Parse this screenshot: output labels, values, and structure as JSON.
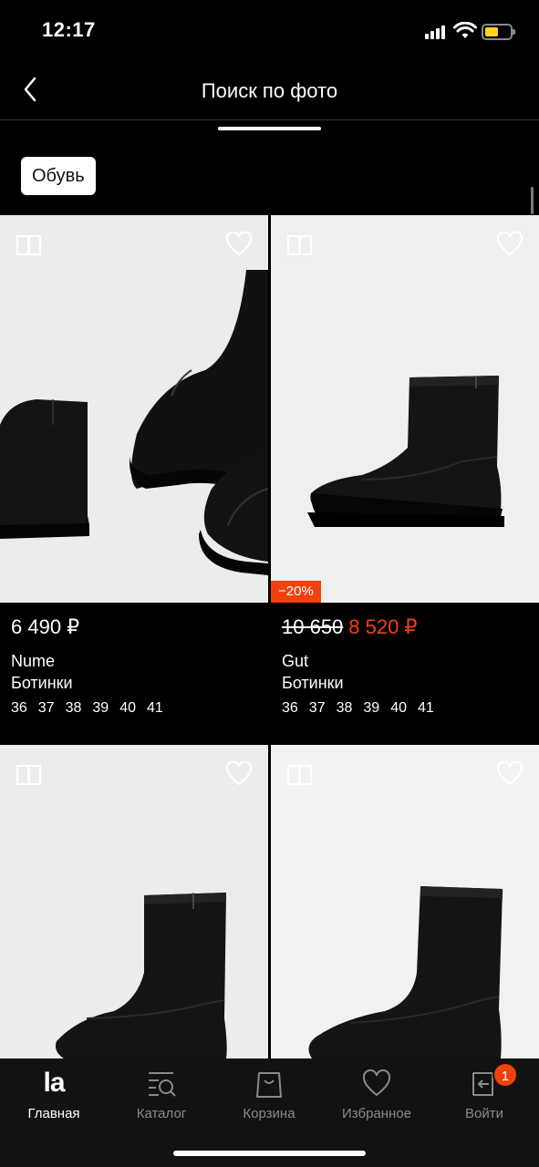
{
  "status_bar": {
    "time": "12:17",
    "battery_level": 0.55,
    "battery_color": "#ffd60a"
  },
  "header": {
    "title": "Поиск по фото",
    "back_icon": "chevron-left-icon"
  },
  "filter": {
    "chip_label": "Обувь"
  },
  "accent_color": "#f0410f",
  "products": [
    {
      "price": "6 490 ₽",
      "old_price": "",
      "brand": "Nume",
      "category": "Ботинки",
      "sizes": [
        "36",
        "37",
        "38",
        "39",
        "40",
        "41"
      ],
      "discount": ""
    },
    {
      "price": "8 520 ₽",
      "old_price": "10 650",
      "brand": "Gut",
      "category": "Ботинки",
      "sizes": [
        "36",
        "37",
        "38",
        "39",
        "40",
        "41"
      ],
      "discount": "−20%"
    },
    {
      "price": "",
      "old_price": "",
      "brand": "",
      "category": "",
      "sizes": [],
      "discount": ""
    },
    {
      "price": "",
      "old_price": "",
      "brand": "",
      "category": "",
      "sizes": [],
      "discount": ""
    }
  ],
  "tab_bar": {
    "tabs": [
      {
        "label": "Главная",
        "icon": "la-logo-icon",
        "logo_text": "la",
        "active": true
      },
      {
        "label": "Каталог",
        "icon": "catalog-search-icon",
        "active": false
      },
      {
        "label": "Корзина",
        "icon": "shopping-bag-icon",
        "active": false
      },
      {
        "label": "Избранное",
        "icon": "heart-icon",
        "active": false
      },
      {
        "label": "Войти",
        "icon": "login-icon",
        "active": false
      }
    ],
    "login_badge": "1"
  }
}
